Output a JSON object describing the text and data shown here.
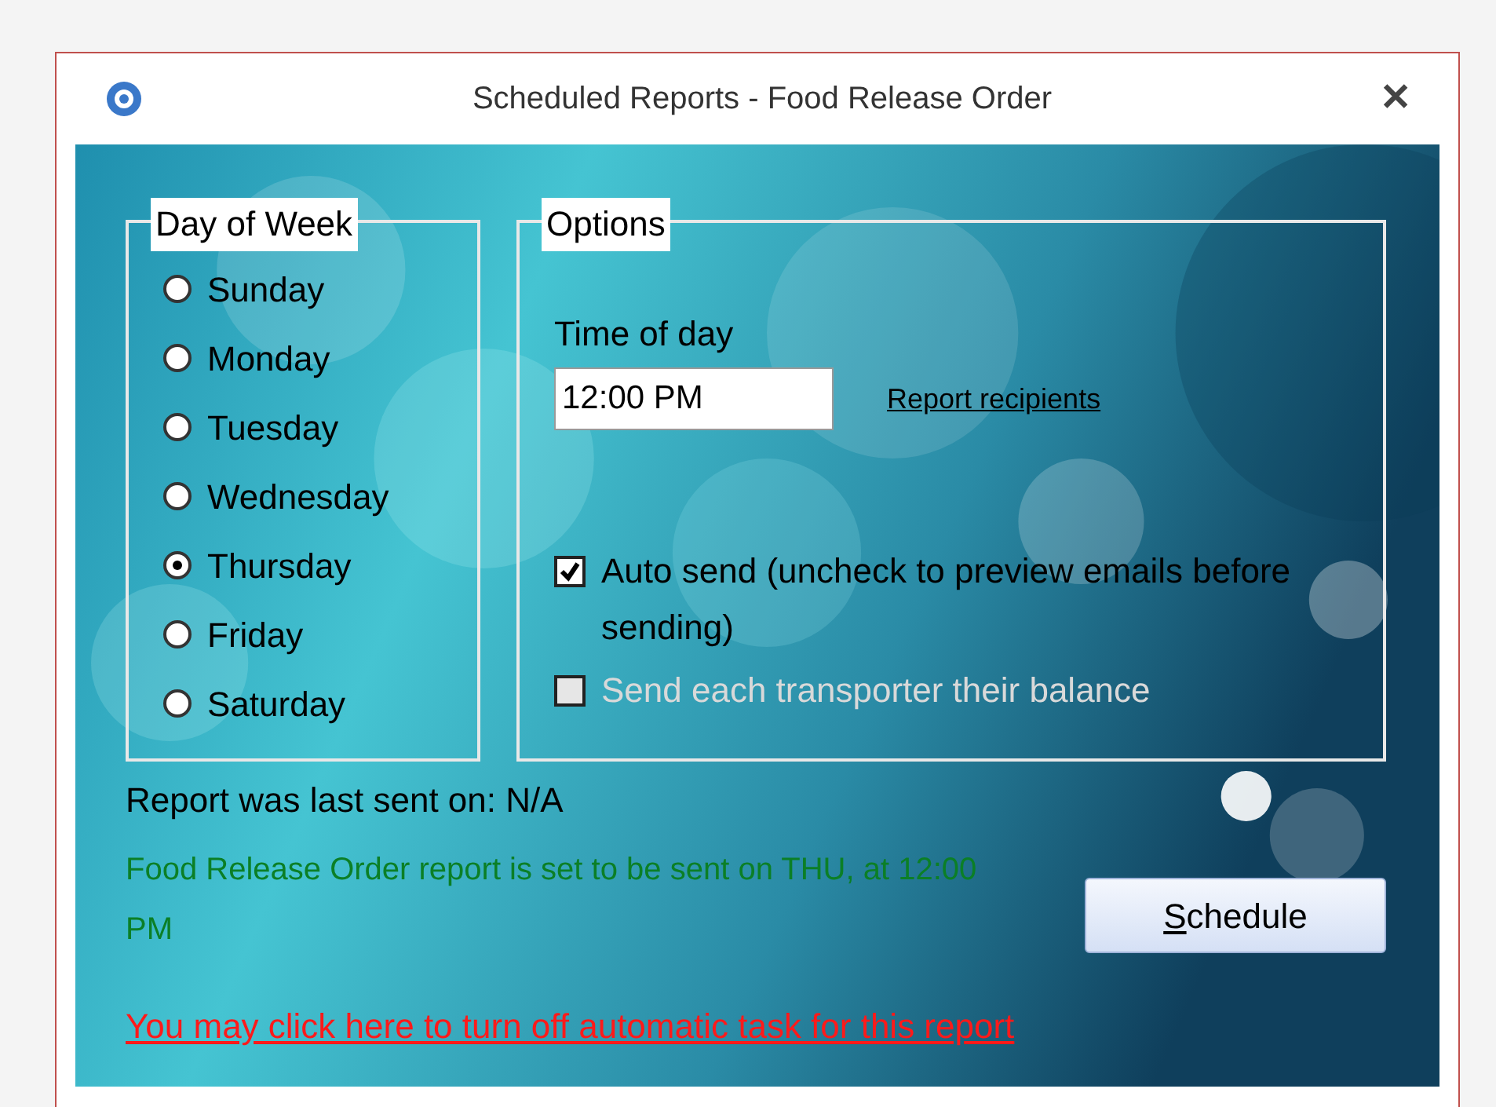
{
  "window": {
    "title": "Scheduled Reports - Food Release Order",
    "close": "✕"
  },
  "day_of_week": {
    "legend": "Day of Week",
    "options": [
      {
        "label": "Sunday",
        "selected": false
      },
      {
        "label": "Monday",
        "selected": false
      },
      {
        "label": "Tuesday",
        "selected": false
      },
      {
        "label": "Wednesday",
        "selected": false
      },
      {
        "label": "Thursday",
        "selected": true
      },
      {
        "label": "Friday",
        "selected": false
      },
      {
        "label": "Saturday",
        "selected": false
      }
    ]
  },
  "options": {
    "legend": "Options",
    "time_label": "Time of day",
    "time_value": "12:00 PM",
    "recipients_link": "Report recipients",
    "checkboxes": [
      {
        "label": "Auto send (uncheck to preview emails before sending)",
        "checked": true,
        "disabled": false
      },
      {
        "label": "Send each transporter their balance",
        "checked": false,
        "disabled": true
      }
    ]
  },
  "last_sent": "Report was last sent on: N/A",
  "schedule_status": "Food Release Order report is set to be sent on THU, at 12:00 PM",
  "schedule_button": {
    "label": "Schedule"
  },
  "turn_off_link": "You may click here to turn off automatic task for this report"
}
